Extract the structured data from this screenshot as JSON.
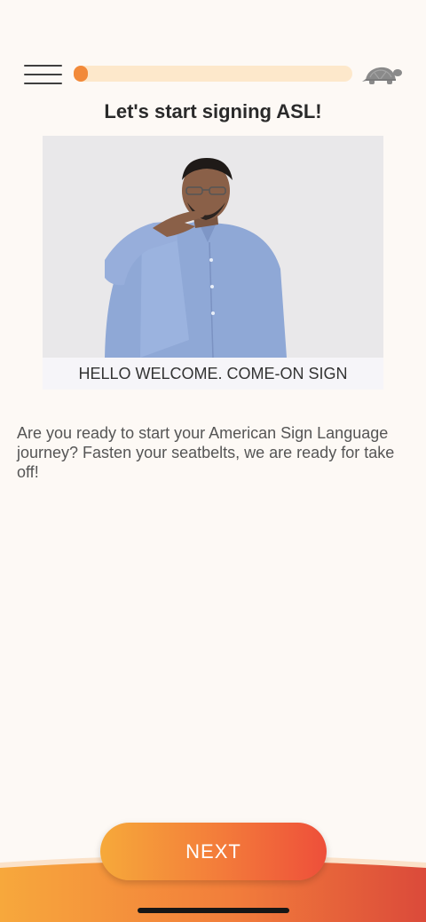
{
  "header": {
    "menu_icon": "hamburger-menu-icon",
    "progress": 0.05,
    "speed_icon": "turtle-icon"
  },
  "title": "Let's start signing ASL!",
  "video": {
    "caption": "HELLO WELCOME. COME-ON SIGN"
  },
  "description": "Are you ready to start your American Sign Language journey? Fasten your seatbelts, we are ready for take off!",
  "footer": {
    "next_label": "NEXT"
  },
  "colors": {
    "background": "#fdf9f5",
    "progress_track": "#fde8cb",
    "progress_fill": "#f28a3a",
    "button_gradient_start": "#f6a93a",
    "button_gradient_end": "#ee4f3a"
  }
}
